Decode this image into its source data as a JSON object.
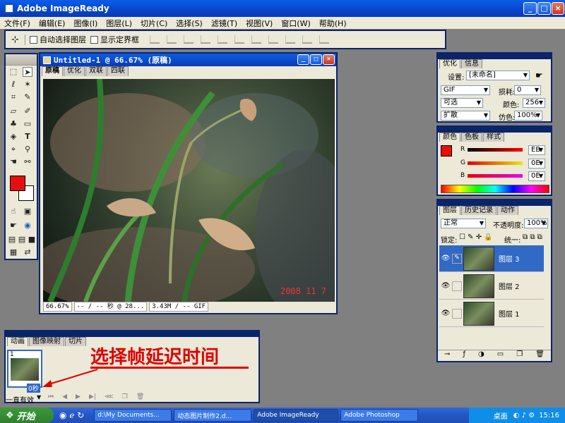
{
  "app": {
    "title": "Adobe ImageReady"
  },
  "menu": [
    "文件(F)",
    "编辑(E)",
    "图像(I)",
    "图层(L)",
    "切片(C)",
    "选择(S)",
    "滤镜(T)",
    "视图(V)",
    "窗口(W)",
    "帮助(H)"
  ],
  "options": {
    "auto_select": "自动选择图层",
    "show_bounds": "显示定界框"
  },
  "document": {
    "title": "Untitled-1 @ 66.67% (原稿)",
    "tabs": [
      "原稿",
      "优化",
      "双联",
      "四联"
    ],
    "date_stamp": "2008 11 7",
    "status": {
      "zoom": "66.67%",
      "time": "-- / -- 秒 @ 28...",
      "size": "3.43M / -- GIF"
    }
  },
  "optimize_panel": {
    "tabs": [
      "优化",
      "信息"
    ],
    "settings_label": "设置:",
    "settings_value": "[未命名]",
    "format": "GIF",
    "lossy_label": "损耗:",
    "lossy_value": "0",
    "palette": "可选",
    "colors_label": "颜色:",
    "colors_value": "256",
    "dither": "扩散",
    "dither_amount_label": "仿色:",
    "dither_amount_value": "100%"
  },
  "color_panel": {
    "tabs": [
      "颜色",
      "色板",
      "样式"
    ],
    "channels": [
      {
        "name": "R",
        "value": "EB"
      },
      {
        "name": "G",
        "value": "0E"
      },
      {
        "name": "B",
        "value": "0E"
      }
    ],
    "foreground": "#e80e0e"
  },
  "layers_panel": {
    "tabs": [
      "图层",
      "历史记录",
      "动作"
    ],
    "blend_mode": "正常",
    "opacity_label": "不透明度:",
    "opacity_value": "100%",
    "lock_label": "锁定:",
    "unify_label": "统一:",
    "layers": [
      {
        "name": "图层 3",
        "selected": true
      },
      {
        "name": "图层 2",
        "selected": false
      },
      {
        "name": "图层 1",
        "selected": false
      }
    ]
  },
  "animation_panel": {
    "tabs": [
      "动画",
      "图像映射",
      "切片"
    ],
    "frame_number": "1",
    "frame_delay": "0秒",
    "loop": "一直有效",
    "annotation": "选择帧延迟时间"
  },
  "toolbox": {
    "fg_color": "#e60e0e",
    "bg_color": "#ffffff"
  },
  "taskbar": {
    "start": "开始",
    "tasks": [
      "d:\\My Documents...",
      "动态图片制作2.d...",
      "Adobe ImageReady",
      "Adobe Photoshop"
    ],
    "tray_label": "桌面",
    "clock": "15:16"
  }
}
